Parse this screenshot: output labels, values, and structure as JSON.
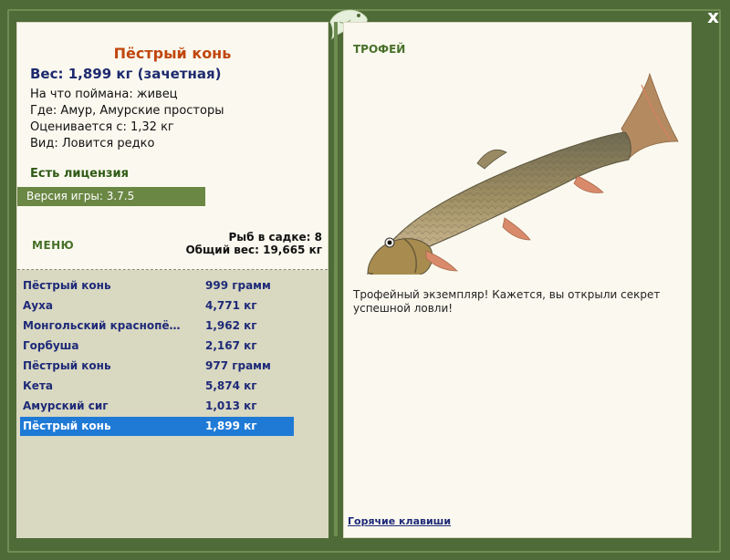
{
  "window": {
    "close_label": "x"
  },
  "fish": {
    "title": "Пёстрый конь",
    "weight": "Вес: 1,899 кг (зачетная)",
    "info": [
      "На что поймана: живец",
      "Где: Амур, Амурские просторы",
      "Оценивается с: 1,32 кг",
      "Вид: Ловится редко"
    ]
  },
  "license": "Есть лицензия",
  "version": "Версия игры: 3.7.5",
  "menu_label": "МЕНЮ",
  "counts": {
    "in_cage": "Рыб в садке: 8",
    "total_weight": "Общий вес: 19,665 кг"
  },
  "catch_list": [
    {
      "name": "Пёстрый конь",
      "weight": "999 грамм"
    },
    {
      "name": "Ауха",
      "weight": "4,771 кг"
    },
    {
      "name": "Монгольский краснопё…",
      "weight": "1,962 кг"
    },
    {
      "name": "Горбуша",
      "weight": "2,167 кг"
    },
    {
      "name": "Пёстрый конь",
      "weight": "977 грамм"
    },
    {
      "name": "Кета",
      "weight": "5,874 кг"
    },
    {
      "name": "Амурский сиг",
      "weight": "1,013 кг"
    },
    {
      "name": "Пёстрый конь",
      "weight": "1,899 кг"
    }
  ],
  "selected_index": 7,
  "trophy": {
    "label": "ТРОФЕЙ",
    "text": "Трофейный экземпляр! Кажется, вы открыли секрет успешной ловли!"
  },
  "hotkeys_label": "Горячие клавиши",
  "colors": {
    "frame": "#4f6b37",
    "panel": "#fbf9ef",
    "list_bg": "#d9d8c1",
    "selected": "#1f7ad6",
    "title": "#c0460d",
    "link": "#1e2a78"
  }
}
